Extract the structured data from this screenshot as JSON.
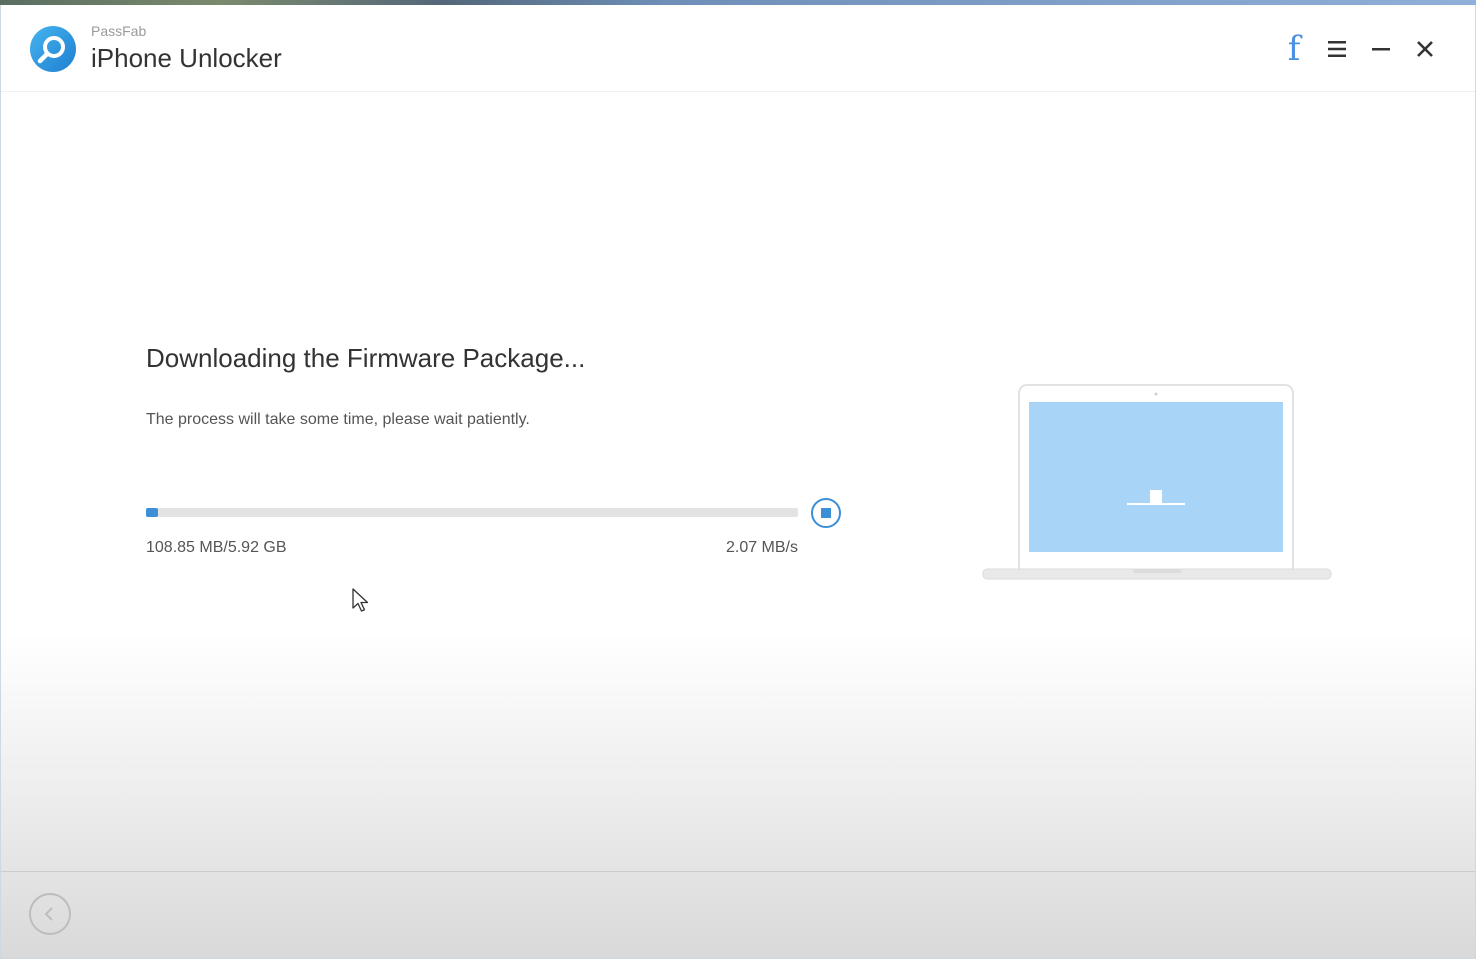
{
  "header": {
    "brand": "PassFab",
    "title": "iPhone Unlocker",
    "facebook_glyph": "f"
  },
  "download": {
    "heading": "Downloading the Firmware Package...",
    "subtext": "The process will take some time, please wait patiently.",
    "progress_fraction": 0.018,
    "size_label": "108.85 MB/5.92 GB",
    "speed_label": "2.07 MB/s"
  },
  "icons": {
    "logo": "passfab-logo-icon",
    "facebook": "facebook-icon",
    "menu": "hamburger-menu-icon",
    "minimize": "minimize-icon",
    "close": "close-icon",
    "stop": "stop-icon",
    "back": "back-arrow-icon",
    "illustration": "laptop-download-icon"
  },
  "colors": {
    "accent": "#3d8fd6",
    "screen": "#a8d4f8",
    "text_primary": "#333333",
    "text_secondary": "#555555"
  }
}
